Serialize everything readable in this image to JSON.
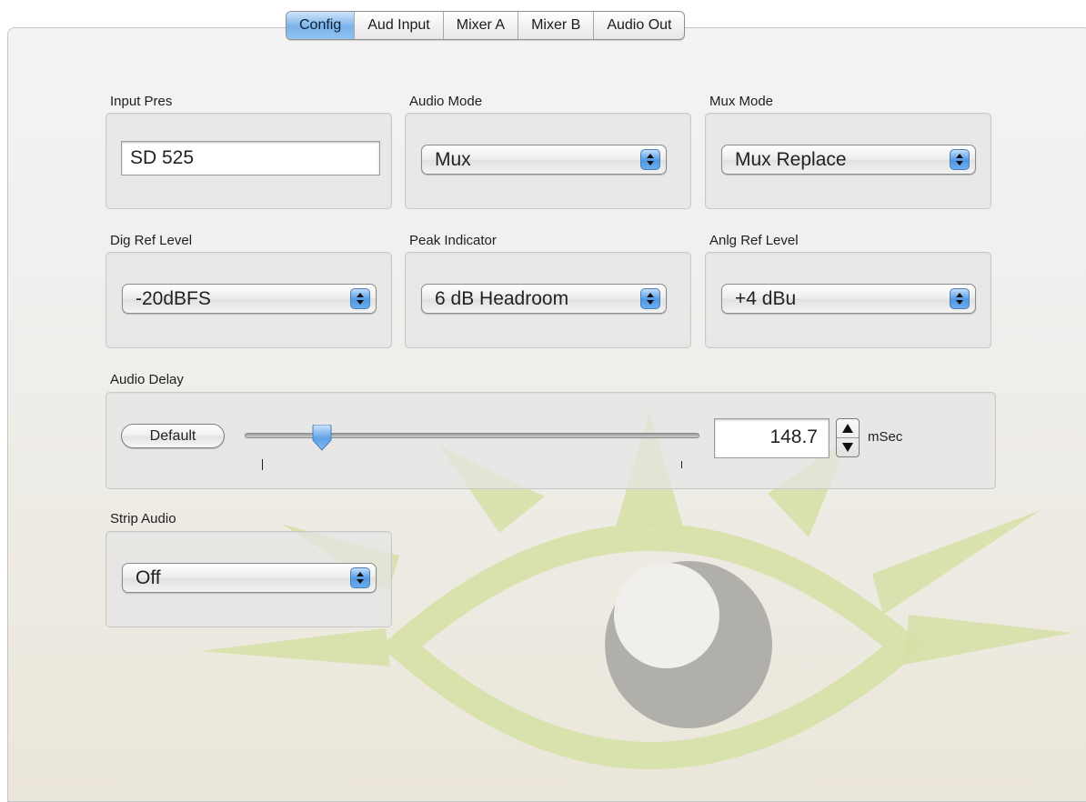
{
  "tabs": [
    "Config",
    "Aud Input",
    "Mixer A",
    "Mixer B",
    "Audio Out"
  ],
  "active_tab": "Config",
  "input_pres": {
    "label": "Input Pres",
    "value": "SD 525"
  },
  "audio_mode": {
    "label": "Audio Mode",
    "value": "Mux"
  },
  "mux_mode": {
    "label": "Mux Mode",
    "value": "Mux Replace"
  },
  "dig_ref_level": {
    "label": "Dig Ref Level",
    "value": "-20dBFS"
  },
  "peak_indicator": {
    "label": "Peak Indicator",
    "value": "6 dB Headroom"
  },
  "anlg_ref_level": {
    "label": "Anlg Ref Level",
    "value": "+4 dBu"
  },
  "audio_delay": {
    "label": "Audio Delay",
    "default_button": "Default",
    "value": "148.7",
    "unit": "mSec",
    "slider_fraction": 0.17
  },
  "strip_audio": {
    "label": "Strip Audio",
    "value": "Off"
  },
  "colors": {
    "tab_active": "#7ab3ea",
    "select_arrow": "#4f98e4",
    "watermark_green": "#d3dfa0",
    "watermark_gray": "#b0aea8"
  },
  "icons": [
    "eye-sun-watermark",
    "popup-arrows-icon",
    "stepper-up-icon",
    "stepper-down-icon",
    "slider-thumb"
  ]
}
